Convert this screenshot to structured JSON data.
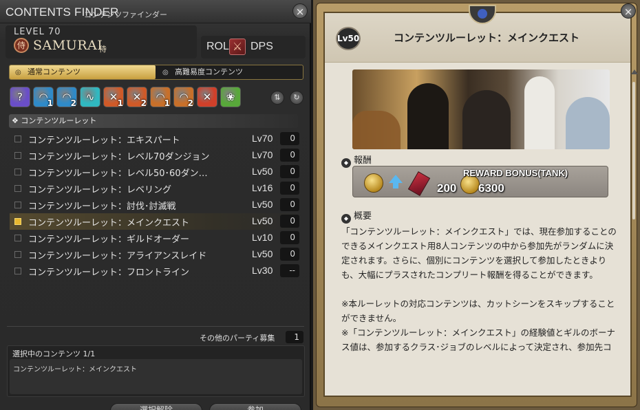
{
  "window": {
    "title": "CONTENTS FINDER",
    "subtitle": "コンテンツファインダー",
    "close_icon": "×"
  },
  "player": {
    "level_label": "LEVEL 70",
    "job_icon": "侍",
    "job_name": "SAMURAI",
    "job_kanji": "侍",
    "role_label": "ROLE",
    "role_value": "DPS"
  },
  "tabs": [
    {
      "label": "通常コンテンツ",
      "active": true
    },
    {
      "label": "高難易度コンテンツ",
      "active": false
    }
  ],
  "duty_icons": [
    {
      "name": "roulette-icon",
      "num": "",
      "color": "#6a4ec8",
      "glyph": "?"
    },
    {
      "name": "dungeon-icon",
      "num": "1",
      "color": "#2f8ac8",
      "glyph": "◠"
    },
    {
      "name": "dungeon-icon",
      "num": "2",
      "color": "#2f8ac8",
      "glyph": "◠"
    },
    {
      "name": "guildhest-icon",
      "num": "",
      "color": "#30b8c0",
      "glyph": "∿"
    },
    {
      "name": "trial-icon",
      "num": "1",
      "color": "#d05a28",
      "glyph": "✕"
    },
    {
      "name": "trial-icon",
      "num": "2",
      "color": "#d05a28",
      "glyph": "✕"
    },
    {
      "name": "raid-icon",
      "num": "1",
      "color": "#c8702a",
      "glyph": "◠"
    },
    {
      "name": "raid-icon",
      "num": "2",
      "color": "#c8702a",
      "glyph": "◠"
    },
    {
      "name": "pvp-icon",
      "num": "",
      "color": "#d0402a",
      "glyph": "✕"
    },
    {
      "name": "gold-saucer-icon",
      "num": "",
      "color": "#58a83a",
      "glyph": "❀"
    }
  ],
  "category": "❖ コンテンツルーレット",
  "duties": [
    {
      "name": "コンテンツルーレット：エキスパート",
      "level": "Lv70",
      "count": "0",
      "selected": false
    },
    {
      "name": "コンテンツルーレット：レベル70ダンジョン",
      "level": "Lv70",
      "count": "0",
      "selected": false
    },
    {
      "name": "コンテンツルーレット：レベル50･60ダン…",
      "level": "Lv50",
      "count": "0",
      "selected": false
    },
    {
      "name": "コンテンツルーレット：レベリング",
      "level": "Lv16",
      "count": "0",
      "selected": false
    },
    {
      "name": "コンテンツルーレット：討伐･討滅戦",
      "level": "Lv50",
      "count": "0",
      "selected": false
    },
    {
      "name": "コンテンツルーレット：メインクエスト",
      "level": "Lv50",
      "count": "0",
      "selected": true
    },
    {
      "name": "コンテンツルーレット：ギルドオーダー",
      "level": "Lv10",
      "count": "0",
      "selected": false
    },
    {
      "name": "コンテンツルーレット：アライアンスレイド",
      "level": "Lv50",
      "count": "0",
      "selected": false
    },
    {
      "name": "コンテンツルーレット：フロントライン",
      "level": "Lv30",
      "count": "--",
      "selected": false
    }
  ],
  "party": {
    "label": "その他のパーティ募集",
    "count": "1"
  },
  "selection": {
    "label": "選択中のコンテンツ 1/1",
    "value": "コンテンツルーレット：メインクエスト"
  },
  "bottom_buttons": [
    {
      "label": "選択解除"
    },
    {
      "label": "参加"
    }
  ],
  "detail": {
    "level_badge": "Lv50",
    "title": "コンテンツルーレット：メインクエスト",
    "reward_heading": "報酬",
    "reward_bonus_label": "REWARD BONUS(TANK)",
    "reward_tomes": "200",
    "reward_gil": "6300",
    "summary_heading": "概要",
    "summary_paragraphs": [
      "「コンテンツルーレット：メインクエスト」では、現在参加することのできるメインクエスト用8人コンテンツの中から参加先がランダムに決定されます。さらに、個別にコンテンツを選択して参加したときよりも、大幅にプラスされたコンプリート報酬を得ることができます。",
      "※本ルーレットの対応コンテンツは、カットシーンをスキップすることができません。",
      "※「コンテンツルーレット：メインクエスト」の経験値とギルのボーナス値は、参加するクラス･ジョブのレベルによって決定され、参加先コンテンツの道中で得られる経験値、ギルとの差"
    ]
  },
  "colors": {
    "accent_gold": "#e8b830",
    "panel_dark": "#2a2a2a",
    "paper": "#e6e1d6"
  }
}
